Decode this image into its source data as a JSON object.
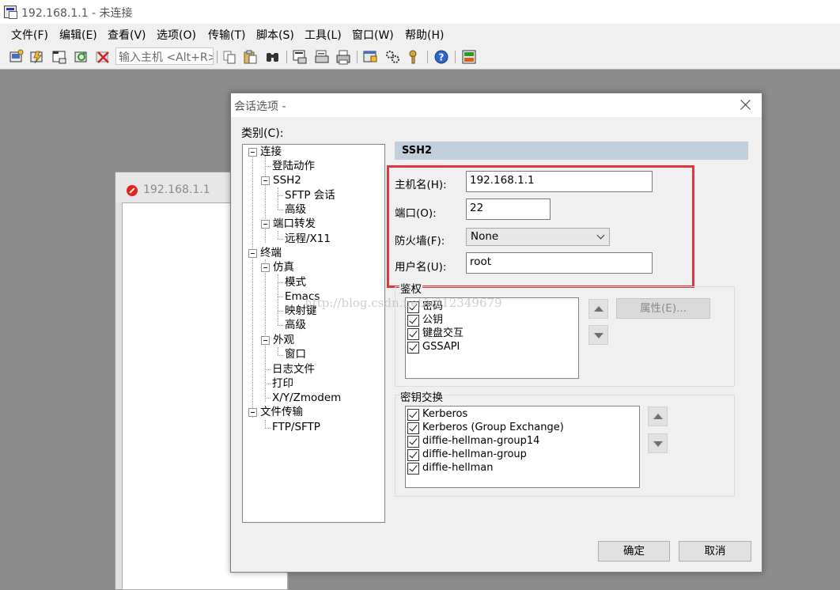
{
  "app": {
    "title": "192.168.1.1 - 未连接"
  },
  "menu": [
    "文件(F)",
    "编辑(E)",
    "查看(V)",
    "选项(O)",
    "传输(T)",
    "脚本(S)",
    "工具(L)",
    "窗口(W)",
    "帮助(H)"
  ],
  "toolbar": {
    "host_input_placeholder": "输入主机 <Alt+R>",
    "buttons": [
      "connect-icon",
      "quick-connect-icon",
      "connect-in-tab-icon",
      "reconnect-icon",
      "disconnect-icon",
      "copy-icon",
      "paste-icon",
      "find-icon",
      "print-setup-icon",
      "print-selection-icon",
      "print-icon",
      "session-options-icon",
      "global-options-icon",
      "keymap-icon",
      "help-icon",
      "sftp-icon"
    ]
  },
  "session_window": {
    "title": "192.168.1.1"
  },
  "dialog": {
    "title": "会话选项 -",
    "category_label": "类别(C):",
    "tree": [
      {
        "label": "连接",
        "level": 0,
        "expanded": true
      },
      {
        "label": "登陆动作",
        "level": 1
      },
      {
        "label": "SSH2",
        "level": 1,
        "expanded": true
      },
      {
        "label": "SFTP 会话",
        "level": 2
      },
      {
        "label": "高级",
        "level": 2
      },
      {
        "label": "端口转发",
        "level": 1,
        "expanded": true
      },
      {
        "label": "远程/X11",
        "level": 2
      },
      {
        "label": "终端",
        "level": 0,
        "expanded": true
      },
      {
        "label": "仿真",
        "level": 1,
        "expanded": true
      },
      {
        "label": "模式",
        "level": 2
      },
      {
        "label": "Emacs",
        "level": 2
      },
      {
        "label": "映射键",
        "level": 2
      },
      {
        "label": "高级",
        "level": 2
      },
      {
        "label": "外观",
        "level": 1,
        "expanded": true
      },
      {
        "label": "窗口",
        "level": 2
      },
      {
        "label": "日志文件",
        "level": 1
      },
      {
        "label": "打印",
        "level": 1
      },
      {
        "label": "X/Y/Zmodem",
        "level": 1
      },
      {
        "label": "文件传输",
        "level": 0,
        "expanded": true
      },
      {
        "label": "FTP/SFTP",
        "level": 1
      }
    ],
    "panel_title": "SSH2",
    "hostname_label": "主机名(H):",
    "hostname_value": "192.168.1.1",
    "port_label": "端口(O):",
    "port_value": "22",
    "firewall_label": "防火墙(F):",
    "firewall_value": "None",
    "username_label": "用户名(U):",
    "username_value": "root",
    "auth_group_label": "鉴权",
    "auth_methods": [
      {
        "label": "密码",
        "checked": true
      },
      {
        "label": "公钥",
        "checked": true
      },
      {
        "label": "键盘交互",
        "checked": true
      },
      {
        "label": "GSSAPI",
        "checked": true
      }
    ],
    "properties_button": "属性(E)...",
    "kex_group_label": "密钥交换",
    "kex_methods": [
      {
        "label": "Kerberos",
        "checked": true
      },
      {
        "label": "Kerberos (Group Exchange)",
        "checked": true
      },
      {
        "label": "diffie-hellman-group14",
        "checked": true
      },
      {
        "label": "diffie-hellman-group",
        "checked": true
      },
      {
        "label": "diffie-hellman",
        "checked": true
      }
    ],
    "ok_button": "确定",
    "cancel_button": "取消"
  },
  "watermark": "http://blog.csdn.net/u012349679",
  "colors": {
    "highlight_box": "#e0353c",
    "panel_header": "#c0cfdb",
    "disconnected_icon": "#e02424"
  }
}
